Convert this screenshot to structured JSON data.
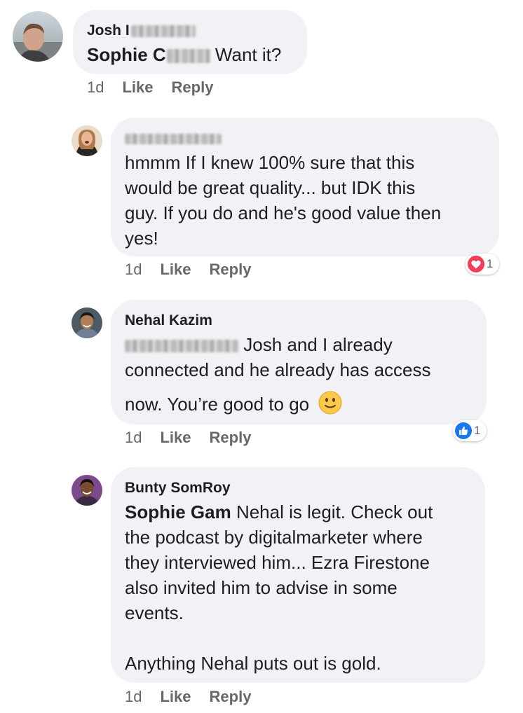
{
  "colors": {
    "bubble": "#f0f2f5",
    "meta": "#65676b",
    "love": "#f33e58",
    "like": "#1877f2"
  },
  "comments": [
    {
      "author": "Josh I",
      "mention": "Sophie C",
      "text": "Want it?",
      "time": "1d",
      "like_label": "Like",
      "reply_label": "Reply"
    },
    {
      "author": "",
      "text_lines": [
        "hmmm If I knew 100% sure that this",
        "would be great quality... but IDK this",
        "guy. If you do and he's good value then",
        "yes!"
      ],
      "time": "1d",
      "like_label": "Like",
      "reply_label": "Reply",
      "reaction": {
        "icon": "heart-icon",
        "count": "1"
      }
    },
    {
      "author": "Nehal Kazim",
      "text_first": "Josh and I already",
      "text_lines": [
        "connected and he already has access",
        "now. You’re good to go"
      ],
      "emoji": "slightly-smiling-face-icon",
      "time": "1d",
      "like_label": "Like",
      "reply_label": "Reply",
      "reaction": {
        "icon": "thumbs-up-icon",
        "count": "1"
      }
    },
    {
      "author": "Bunty SomRoy",
      "mention": "Sophie Gam",
      "text_first": "Nehal is legit. Check out",
      "text_lines": [
        "the podcast by digitalmarketer where",
        "they interviewed him... Ezra Firestone",
        "also invited him to advise in some",
        "events.",
        "",
        "Anything Nehal puts out is gold."
      ],
      "time": "1d",
      "like_label": "Like",
      "reply_label": "Reply"
    }
  ]
}
